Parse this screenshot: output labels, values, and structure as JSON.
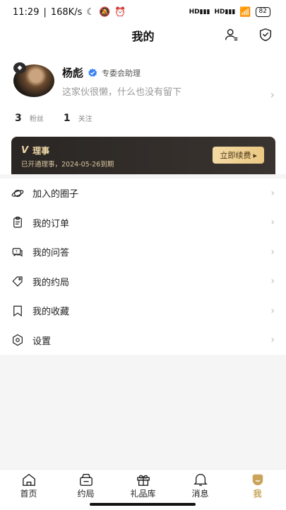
{
  "status": {
    "time": "11:29",
    "speed": "168K/s",
    "battery": "82",
    "hd1": "HD",
    "hd2": "HD"
  },
  "header": {
    "title": "我的"
  },
  "profile": {
    "name": "杨彪",
    "role": "专委会助理",
    "bio": "这家伙很懒，什么也没有留下",
    "fans_count": "3",
    "fans_label": "粉丝",
    "follow_count": "1",
    "follow_label": "关注"
  },
  "vip": {
    "mark": "V",
    "title": "理事",
    "subtitle": "已开通理事，2024-05-26到期",
    "renew_label": "立即续费",
    "renew_arrow": "▸"
  },
  "menu": [
    {
      "label": "加入的圈子",
      "icon": "planet-icon"
    },
    {
      "label": "我的订单",
      "icon": "order-icon"
    },
    {
      "label": "我的问答",
      "icon": "qa-icon"
    },
    {
      "label": "我的约局",
      "icon": "ticket-icon"
    },
    {
      "label": "我的收藏",
      "icon": "bookmark-icon"
    },
    {
      "label": "设置",
      "icon": "settings-icon"
    }
  ],
  "tabs": [
    {
      "label": "首页",
      "icon": "home-icon"
    },
    {
      "label": "约局",
      "icon": "meetup-icon"
    },
    {
      "label": "礼品库",
      "icon": "gift-icon"
    },
    {
      "label": "消息",
      "icon": "bell-icon"
    },
    {
      "label": "我",
      "icon": "me-icon",
      "active": true
    }
  ],
  "colors": {
    "accent_gold": "#c9a45a",
    "vip_bg": "#2a2623",
    "verified_blue": "#3b82f6"
  }
}
